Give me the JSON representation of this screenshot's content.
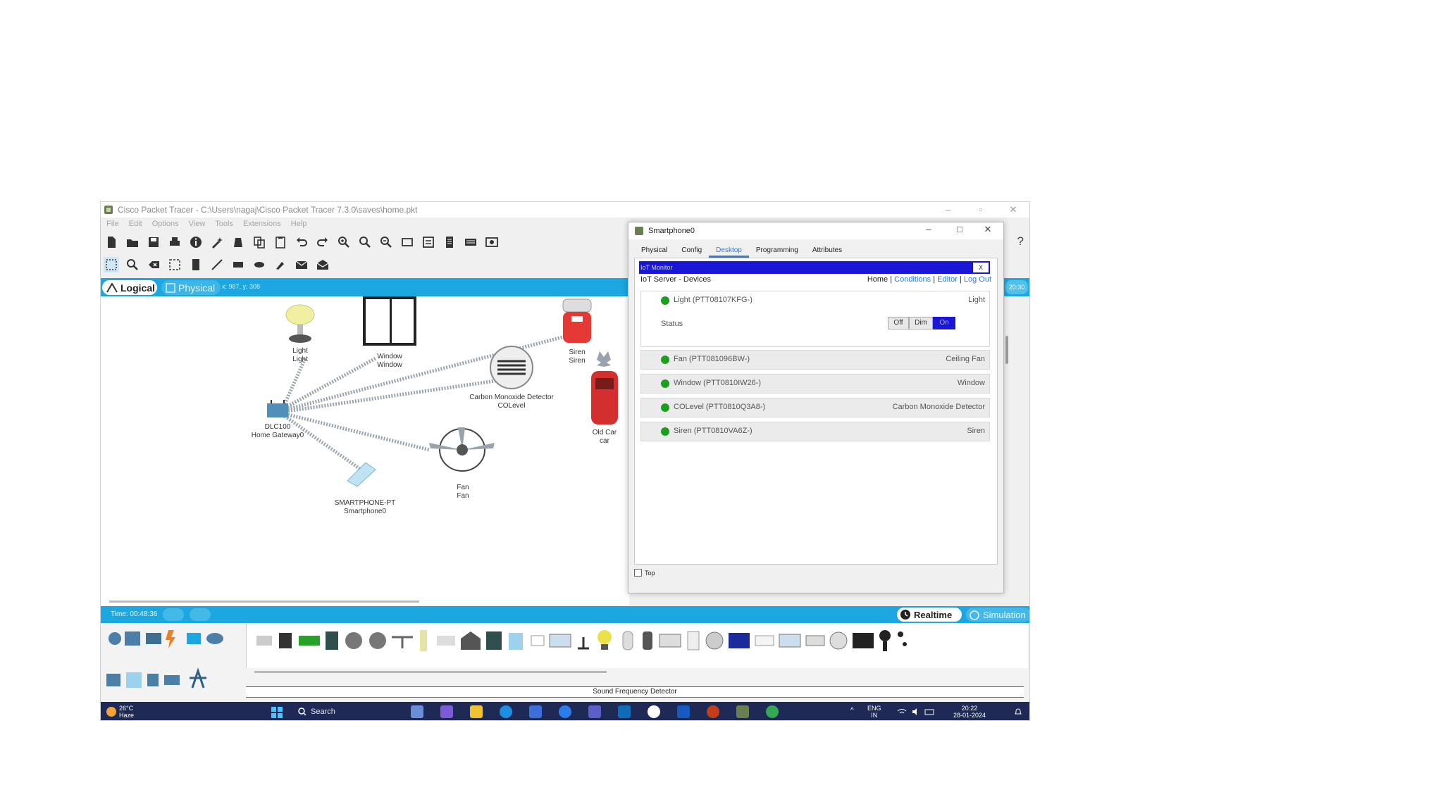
{
  "window": {
    "title": "Cisco Packet Tracer - C:\\Users\\nagaj\\Cisco Packet Tracer 7.3.0\\saves\\home.pkt",
    "menu": [
      "File",
      "Edit",
      "Options",
      "View",
      "Tools",
      "Extensions",
      "Help"
    ],
    "help": "?"
  },
  "modebar": {
    "logical": "Logical",
    "physical": "Physical",
    "coords": "x: 987, y: 308",
    "clock": "20:30"
  },
  "workspace": {
    "devices": [
      {
        "label1": "Light",
        "label2": "Light"
      },
      {
        "label1": "Window",
        "label2": "Window"
      },
      {
        "label1": "Siren",
        "label2": "Siren"
      },
      {
        "label1": "Carbon Monoxide Detector",
        "label2": "COLevel"
      },
      {
        "label1": "Old Car",
        "label2": "car"
      },
      {
        "label1": "DLC100",
        "label2": "Home Gateway0"
      },
      {
        "label1": "Fan",
        "label2": "Fan"
      },
      {
        "label1": "SMARTPHONE-PT",
        "label2": "Smartphone0"
      }
    ]
  },
  "timebar": {
    "time": "Time: 00:48:36",
    "realtime": "Realtime",
    "simulation": "Simulation"
  },
  "palette": {
    "selected_label": "Sound Frequency Detector"
  },
  "taskbar": {
    "temp": "26°C",
    "weather": "Haze",
    "search": "Search",
    "lang1": "ENG",
    "lang2": "IN",
    "time": "20:22",
    "date": "28-01-2024"
  },
  "smartphone": {
    "title": "Smartphone0",
    "tabs": [
      "Physical",
      "Config",
      "Desktop",
      "Programming",
      "Attributes"
    ],
    "active_tab": "Desktop",
    "iot_header": "IoT Monitor",
    "close": "X",
    "server_label": "IoT Server - Devices",
    "nav": {
      "home": "Home",
      "conditions": "Conditions",
      "editor": "Editor",
      "logout": "Log Out"
    },
    "devices": [
      {
        "name": "Light (PTT08107KFG-)",
        "type": "Light"
      },
      {
        "name": "Fan (PTT081096BW-)",
        "type": "Ceiling Fan"
      },
      {
        "name": "Window (PTT0810IW26-)",
        "type": "Window"
      },
      {
        "name": "COLevel (PTT0810Q3A8-)",
        "type": "Carbon Monoxide Detector"
      },
      {
        "name": "Siren (PTT0810VA6Z-)",
        "type": "Siren"
      }
    ],
    "status_label": "Status",
    "status_options": [
      "Off",
      "Dim",
      "On"
    ],
    "status_selected": "On",
    "top_checkbox": "Top"
  },
  "colors": {
    "accent_blue": "#1ca7e0",
    "iot_header_blue": "#1a16d8",
    "status_green": "#1e9e1e",
    "taskbar": "#1e2a55"
  }
}
